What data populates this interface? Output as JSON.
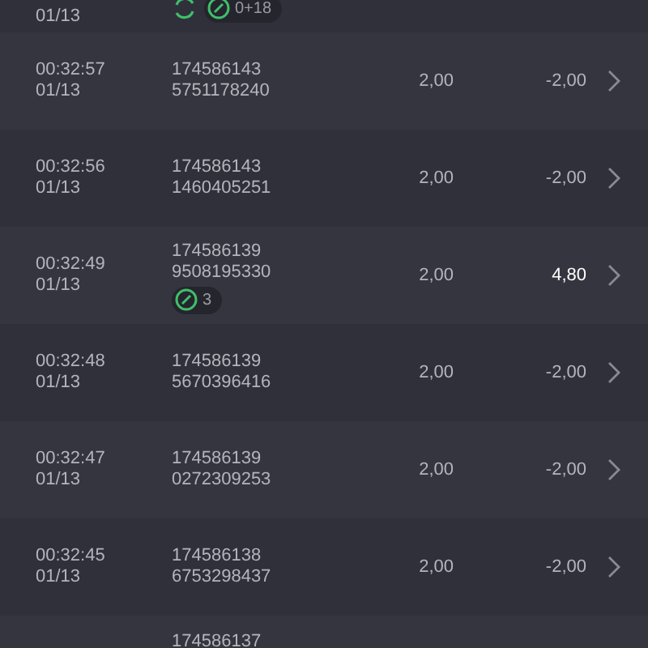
{
  "rows": [
    {
      "date": "01/13",
      "badges": [
        {
          "kind": "refresh"
        },
        {
          "kind": "count",
          "text": "0+18"
        }
      ]
    },
    {
      "time": "00:32:57",
      "date": "01/13",
      "ids": [
        "174586143",
        "5751178240"
      ],
      "stake": "2,00",
      "result": "-2,00",
      "won": false
    },
    {
      "time": "00:32:56",
      "date": "01/13",
      "ids": [
        "174586143",
        "1460405251"
      ],
      "stake": "2,00",
      "result": "-2,00",
      "won": false
    },
    {
      "time": "00:32:49",
      "date": "01/13",
      "ids": [
        "174586139",
        "9508195330"
      ],
      "badges": [
        {
          "kind": "count",
          "text": "3"
        }
      ],
      "stake": "2,00",
      "result": "4,80",
      "won": true
    },
    {
      "time": "00:32:48",
      "date": "01/13",
      "ids": [
        "174586139",
        "5670396416"
      ],
      "stake": "2,00",
      "result": "-2,00",
      "won": false
    },
    {
      "time": "00:32:47",
      "date": "01/13",
      "ids": [
        "174586139",
        "0272309253"
      ],
      "stake": "2,00",
      "result": "-2,00",
      "won": false
    },
    {
      "time": "00:32:45",
      "date": "01/13",
      "ids": [
        "174586138",
        "6753298437"
      ],
      "stake": "2,00",
      "result": "-2,00",
      "won": false
    },
    {
      "ids": [
        "174586137"
      ]
    }
  ]
}
